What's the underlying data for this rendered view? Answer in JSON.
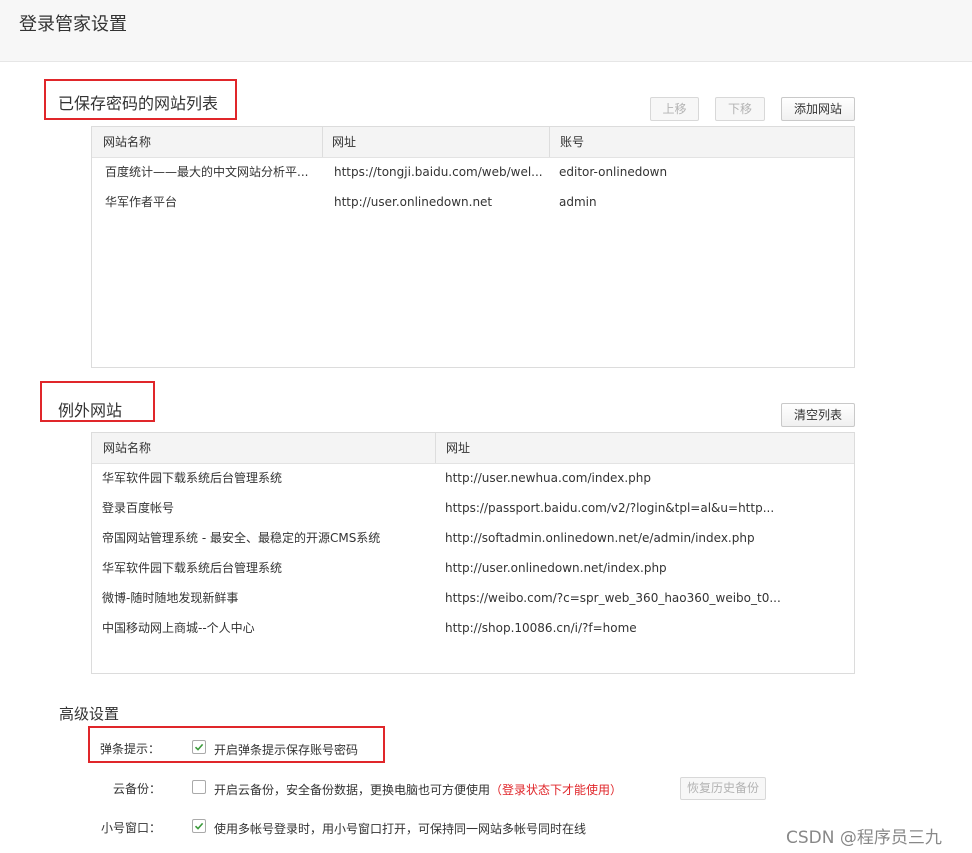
{
  "header": {
    "title": "登录管家设置"
  },
  "saved_sites": {
    "title": "已保存密码的网站列表",
    "buttons": {
      "move_up": "上移",
      "move_down": "下移",
      "add": "添加网站"
    },
    "columns": [
      "网站名称",
      "网址",
      "账号"
    ],
    "rows": [
      {
        "name": "百度统计——最大的中文网站分析平...",
        "url": "https://tongji.baidu.com/web/wel...",
        "account": "editor-onlinedown"
      },
      {
        "name": "华军作者平台",
        "url": "http://user.onlinedown.net",
        "account": "admin"
      }
    ]
  },
  "exceptions": {
    "title": "例外网站",
    "buttons": {
      "clear": "清空列表"
    },
    "columns": [
      "网站名称",
      "网址"
    ],
    "rows": [
      {
        "name": "华军软件园下载系统后台管理系统",
        "url": "http://user.newhua.com/index.php"
      },
      {
        "name": "登录百度帐号",
        "url": "https://passport.baidu.com/v2/?login&tpl=al&u=http..."
      },
      {
        "name": "帝国网站管理系统 - 最安全、最稳定的开源CMS系统",
        "url": "http://softadmin.onlinedown.net/e/admin/index.php"
      },
      {
        "name": "华军软件园下载系统后台管理系统",
        "url": "http://user.onlinedown.net/index.php"
      },
      {
        "name": "微博-随时随地发现新鲜事",
        "url": "https://weibo.com/?c=spr_web_360_hao360_weibo_t0..."
      },
      {
        "name": "中国移动网上商城--个人中心",
        "url": "http://shop.10086.cn/i/?f=home"
      }
    ]
  },
  "advanced": {
    "title": "高级设置",
    "popup": {
      "label": "弹条提示：",
      "checked": true,
      "text": "开启弹条提示保存账号密码"
    },
    "cloud": {
      "label": "云备份：",
      "checked": false,
      "text": "开启云备份，安全备份数据，更换电脑也可方便使用",
      "note": "（登录状态下才能使用）",
      "restore_button": "恢复历史备份"
    },
    "small_window": {
      "label": "小号窗口：",
      "checked": true,
      "text": "使用多帐号登录时，用小号窗口打开，可保持同一网站多帐号同时在线"
    }
  },
  "watermark": "CSDN @程序员三九",
  "colors": {
    "highlight_box": "#e0262a",
    "header_bg": "#f7f7f7",
    "table_header_bg": "#f4f4f4"
  }
}
